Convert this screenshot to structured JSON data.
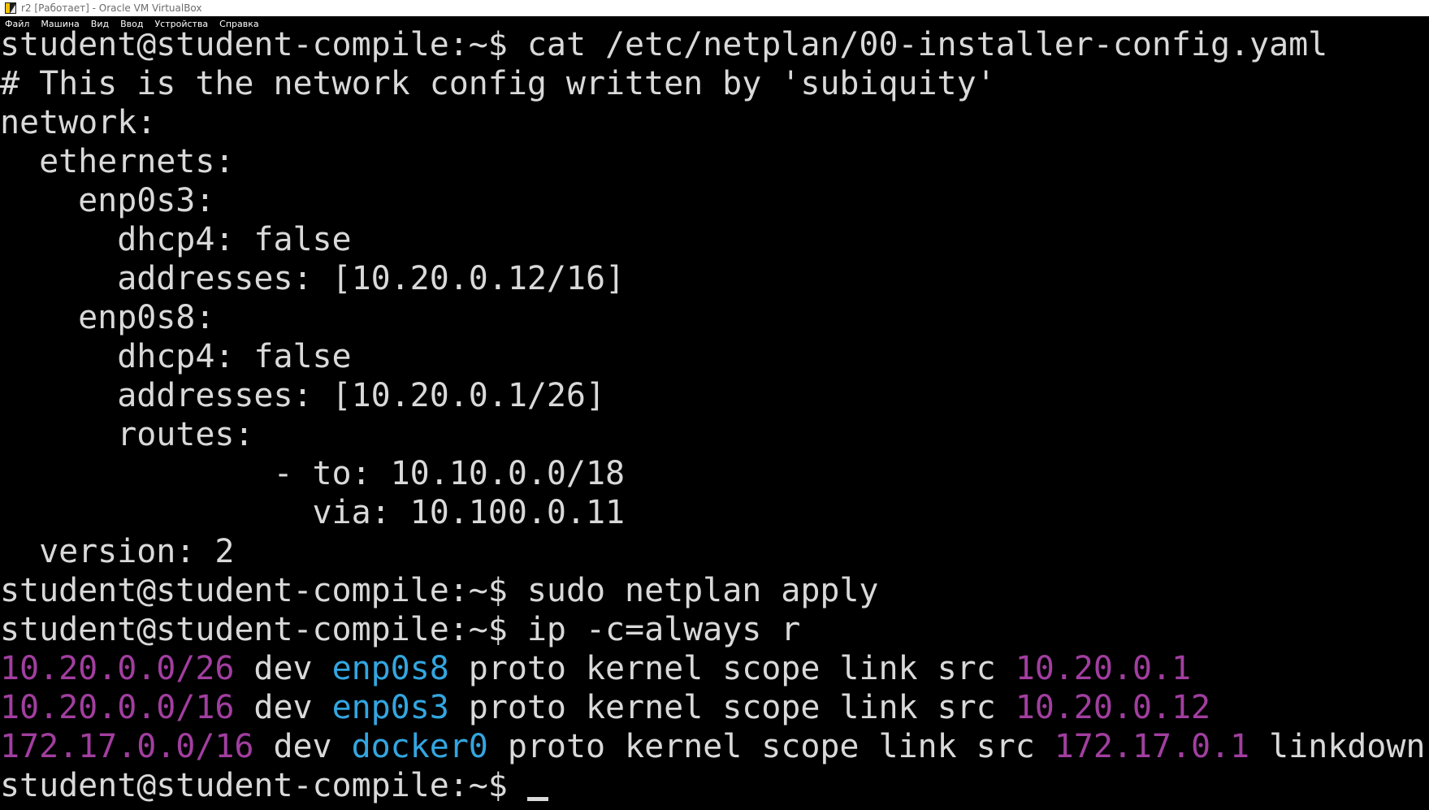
{
  "window": {
    "title": "r2 [Работает] - Oracle VM VirtualBox"
  },
  "menu": {
    "items": [
      "Файл",
      "Машина",
      "Вид",
      "Ввод",
      "Устройства",
      "Справка"
    ]
  },
  "terminal": {
    "prompt": "student@student-compile:~$ ",
    "commands": {
      "cat": "cat /etc/netplan/00-installer-config.yaml",
      "apply": "sudo netplan apply",
      "route": "ip -c=always r"
    },
    "yaml_lines": [
      "# This is the network config written by 'subiquity'",
      "network:",
      "  ethernets:",
      "    enp0s3:",
      "      dhcp4: false",
      "      addresses: [10.20.0.12/16]",
      "    enp0s8:",
      "      dhcp4: false",
      "      addresses: [10.20.0.1/26]",
      "      routes:",
      "              - to: 10.10.0.0/18",
      "                via: 10.100.0.11",
      "  version: 2"
    ],
    "routes": [
      {
        "net": "10.20.0.0/26",
        "dev_kw": " dev ",
        "dev": "enp0s8",
        "mid": " proto kernel scope link src ",
        "src": "10.20.0.1",
        "tail": ""
      },
      {
        "net": "10.20.0.0/16",
        "dev_kw": " dev ",
        "dev": "enp0s3",
        "mid": " proto kernel scope link src ",
        "src": "10.20.0.12",
        "tail": ""
      },
      {
        "net": "172.17.0.0/16",
        "dev_kw": " dev ",
        "dev": "docker0",
        "mid": " proto kernel scope link src ",
        "src": "172.17.0.1",
        "tail": " linkdown"
      }
    ]
  },
  "colors": {
    "terminal_bg": "#000000",
    "terminal_fg": "#d9d9d9",
    "ip_magenta": "#a23ea0",
    "dev_cyan": "#33a6e0"
  },
  "icons": {
    "app": "virtualbox-icon"
  }
}
